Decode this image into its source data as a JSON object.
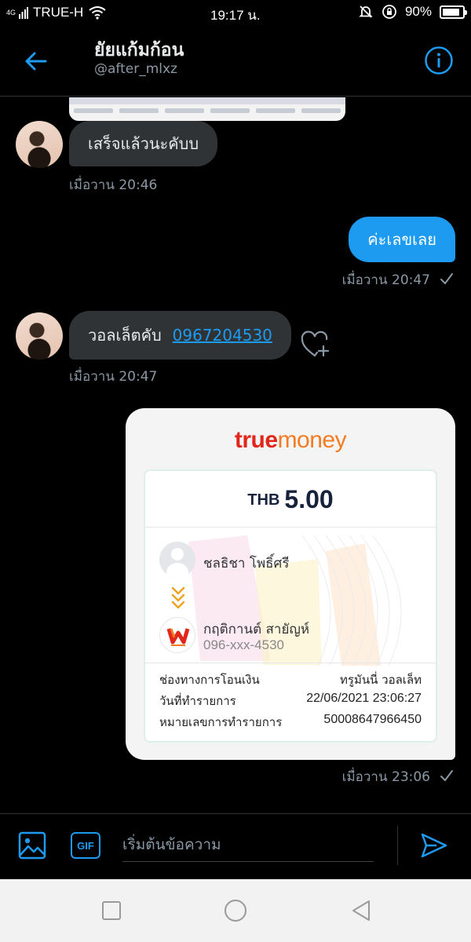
{
  "status_bar": {
    "network_type": "4G",
    "carrier": "TRUE-H",
    "time": "19:17 น.",
    "battery": "90%",
    "battery_level": 0.9
  },
  "header": {
    "name": "ยัยแก้มก้อน",
    "handle": "@after_mlxz"
  },
  "messages": [
    {
      "direction": "in",
      "text": "เสร็จแล้วนะคับบ",
      "time": "เมื่อวาน 20:46"
    },
    {
      "direction": "out",
      "text": "ค่ะเลขเลย",
      "time": "เมื่อวาน 20:47"
    },
    {
      "direction": "in",
      "text": "วอลเล็ตคับ",
      "link": "0967204530",
      "time": "เมื่อวาน 20:47"
    },
    {
      "direction": "out",
      "type": "image",
      "time": "เมื่อวาน 23:06"
    }
  ],
  "receipt": {
    "brand_true": "true",
    "brand_money": "money",
    "currency": "THB",
    "amount": "5.00",
    "sender_name": "ชลธิชา โพธิ์ศรี",
    "receiver_name": "กฤติกานต์ สายัญห์",
    "receiver_phone": "096-xxx-4530",
    "details": [
      {
        "label": "ช่องทางการโอนเงิน",
        "value": "ทรูมันนี่ วอลเล็ท"
      },
      {
        "label": "วันที่ทำรายการ",
        "value": "22/06/2021 23:06:27"
      },
      {
        "label": "หมายเลขการทำรายการ",
        "value": "50008647966450"
      }
    ]
  },
  "composer": {
    "gif_label": "GIF",
    "placeholder": "เริ่มต้นข้อความ"
  },
  "colors": {
    "accent": "#1d9bf0",
    "bubble_in": "#2f3336",
    "truemoney_red": "#e1261c",
    "truemoney_orange": "#f47b20"
  }
}
